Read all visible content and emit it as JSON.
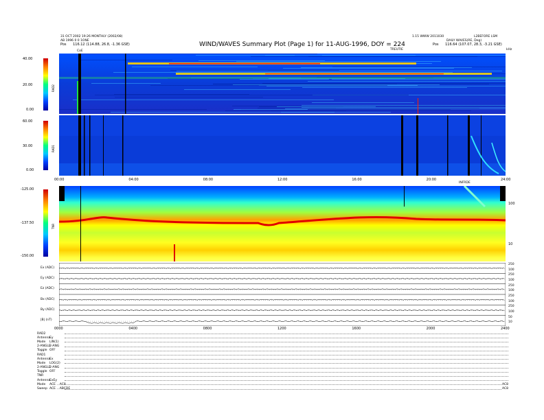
{
  "header": {
    "line1_left": "31 OCT 2002 19:26 MONTHLY (2002/08) ",
    "line1_left_b": "AB 1996 0 0 1ONE",
    "pos_left_label": "Pos",
    "pos_left_value": "116.12 (114.88, 26.8, -1.36 GSE)",
    "line1_right": "1.15 WWW 2011030",
    "line1_right_b": "L2BEFORE LSM",
    "line2_right": "DAILY WAVES(RE, Deg)",
    "pos_right_label": "Pos",
    "pos_right_value": "116.64 (107.07, 28.3, -3.21 GSE)",
    "top_marker_left": "CoE",
    "top_marker_mid": "TREUTIE",
    "top_marker_right": "kHz"
  },
  "title": "WIND/WAVES Summary Plot (Page 1) for 11-AUG-1996, DOY = 224",
  "panels": {
    "rad2": {
      "name": "RAD2",
      "yticks": [
        "40.00",
        "20.00",
        "0.00"
      ]
    },
    "rad1": {
      "name": "RAD1",
      "yticks": [
        "60.00",
        "30.00",
        "0.00"
      ]
    },
    "tnr": {
      "name": "TNR",
      "yticks": [
        "-125.00",
        "-137.50",
        "-150.00"
      ],
      "right_ticks": [
        "100",
        "10"
      ],
      "marker": "INFRDE"
    }
  },
  "time_axis": [
    "00:00",
    "04:00",
    "08:00",
    "12:00",
    "16:00",
    "20:00",
    "24:00"
  ],
  "time_axis_bottom": [
    "0000",
    "0400",
    "0800",
    "1200",
    "1600",
    "2000",
    "2400"
  ],
  "line_panels": [
    {
      "label": "Ex (ADC)",
      "right": [
        "250",
        "100"
      ]
    },
    {
      "label": "Ey (ADC)",
      "right": [
        "250",
        "100"
      ]
    },
    {
      "label": "Ez (ADC)",
      "right": [
        "250",
        "100"
      ]
    },
    {
      "label": "Bx (ADC)",
      "right": [
        "250",
        "100"
      ]
    },
    {
      "label": "By (ADC)",
      "right": [
        "250",
        "100"
      ]
    },
    {
      "label": "|B| (nT)",
      "right": [
        "50",
        "10"
      ]
    }
  ],
  "footer": [
    {
      "k": "RAD2",
      "v": ""
    },
    {
      "k": "Antenna",
      "v": "Ey"
    },
    {
      "k": "Mode",
      "v": "LIN(1)"
    },
    {
      "k": "2-ANGLE",
      "v": "2-ANG"
    },
    {
      "k": "Toggle",
      "v": "OFF"
    },
    {
      "k": "RAD1",
      "v": ""
    },
    {
      "k": "Antenna",
      "v": "Ex"
    },
    {
      "k": "Mode",
      "v": "LOG(2)"
    },
    {
      "k": "2-ANGLE",
      "v": "2-ANG"
    },
    {
      "k": "Toggle",
      "v": "OFF"
    },
    {
      "k": "TNR",
      "v": ""
    },
    {
      "k": "Antenna",
      "v": "ExEy"
    },
    {
      "k": "Mode",
      "v": "ACE ...AC8"
    },
    {
      "k": "Sweep",
      "v": "ACE ...ABCDE"
    }
  ],
  "footer_end": "AC8",
  "chart_data": [
    {
      "type": "heatmap",
      "title": "RAD2",
      "x": [
        "00:00",
        "24:00"
      ],
      "ylim": [
        0,
        40
      ],
      "ylabel": "RAD2",
      "colors": [
        "#0000a0",
        "#0040ff",
        "#00c8ff",
        "#00ff80",
        "#ffff00",
        "#ff8000",
        "#d00000"
      ]
    },
    {
      "type": "heatmap",
      "title": "RAD1",
      "x": [
        "00:00",
        "24:00"
      ],
      "ylim": [
        0,
        60
      ],
      "ylabel": "RAD1"
    },
    {
      "type": "heatmap",
      "title": "TNR",
      "x": [
        "00:00",
        "24:00"
      ],
      "ylim": [
        -150,
        -125
      ],
      "ylabel": "TNR"
    }
  ]
}
